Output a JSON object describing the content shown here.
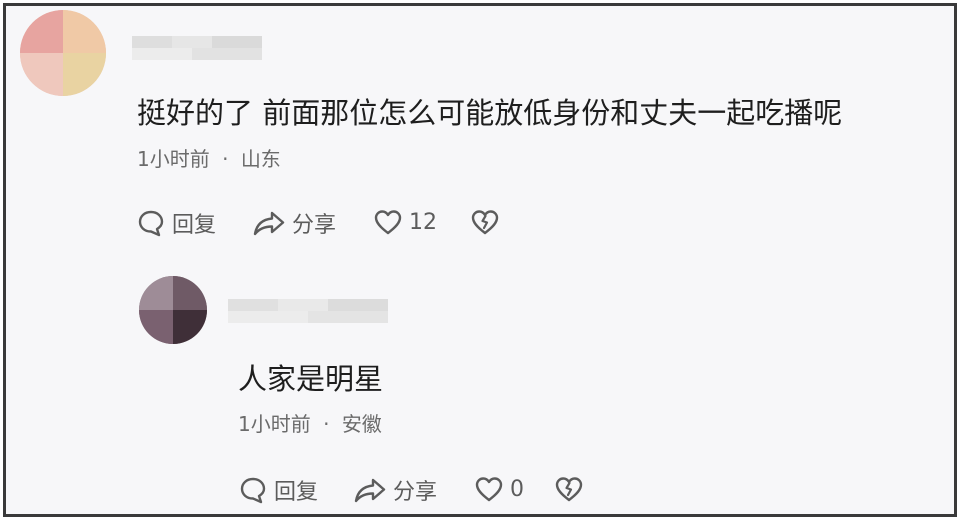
{
  "comments": [
    {
      "text": "挺好的了 前面那位怎么可能放低身份和丈夫一起吃播呢",
      "time": "1小时前",
      "separator": "·",
      "location": "山东",
      "actions": {
        "reply": "回复",
        "share": "分享",
        "likes": "12"
      }
    },
    {
      "text": "人家是明星",
      "time": "1小时前",
      "separator": "·",
      "location": "安徽",
      "actions": {
        "reply": "回复",
        "share": "分享",
        "likes": "0"
      }
    }
  ]
}
